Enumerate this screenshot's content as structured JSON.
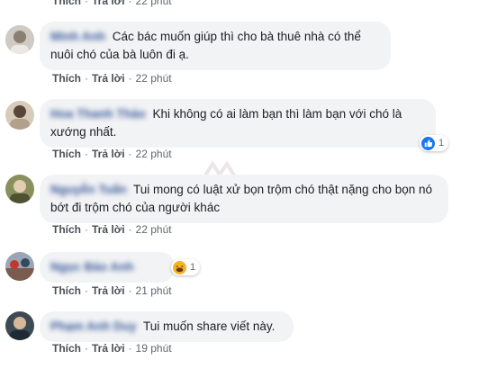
{
  "comments": [
    {
      "name": "Minh Anh",
      "text": "Các bác muốn giúp thì cho bà thuê nhà có thể nuôi chó của bà luôn đi ạ.",
      "like": "Thích",
      "reply": "Trả lời",
      "time": "22 phút"
    },
    {
      "name": "Hoa Thanh Thảo",
      "text": "Khi không có ai làm bạn thì làm bạn với chó là xướng nhất.",
      "like": "Thích",
      "reply": "Trả lời",
      "time": "22 phút",
      "reaction_count": "1"
    },
    {
      "name": "Nguyễn Tuấn",
      "text": "Tui mong có luật xử bọn trộm chó thật nặng cho bọn nó bớt đi trộm chó của người khác",
      "like": "Thích",
      "reply": "Trả lời",
      "time": "22 phút"
    },
    {
      "name": "Ngọc Bảo Anh",
      "text": "",
      "like": "Thích",
      "reply": "Trả lời",
      "time": "21 phút",
      "reaction_count": "1"
    },
    {
      "name": "Phạm Anh Duy",
      "text": "Tui muốn share viết này.",
      "like": "Thích",
      "reply": "Trả lời",
      "time": "19 phút"
    }
  ],
  "top_partial": {
    "like": "Thích",
    "reply": "Trả lời",
    "time": "22 phút"
  },
  "colors": {
    "bubble": "#f2f3f5",
    "name": "#385898",
    "like_blue": "#1877f2",
    "haha_yellow": "#f7b125"
  }
}
